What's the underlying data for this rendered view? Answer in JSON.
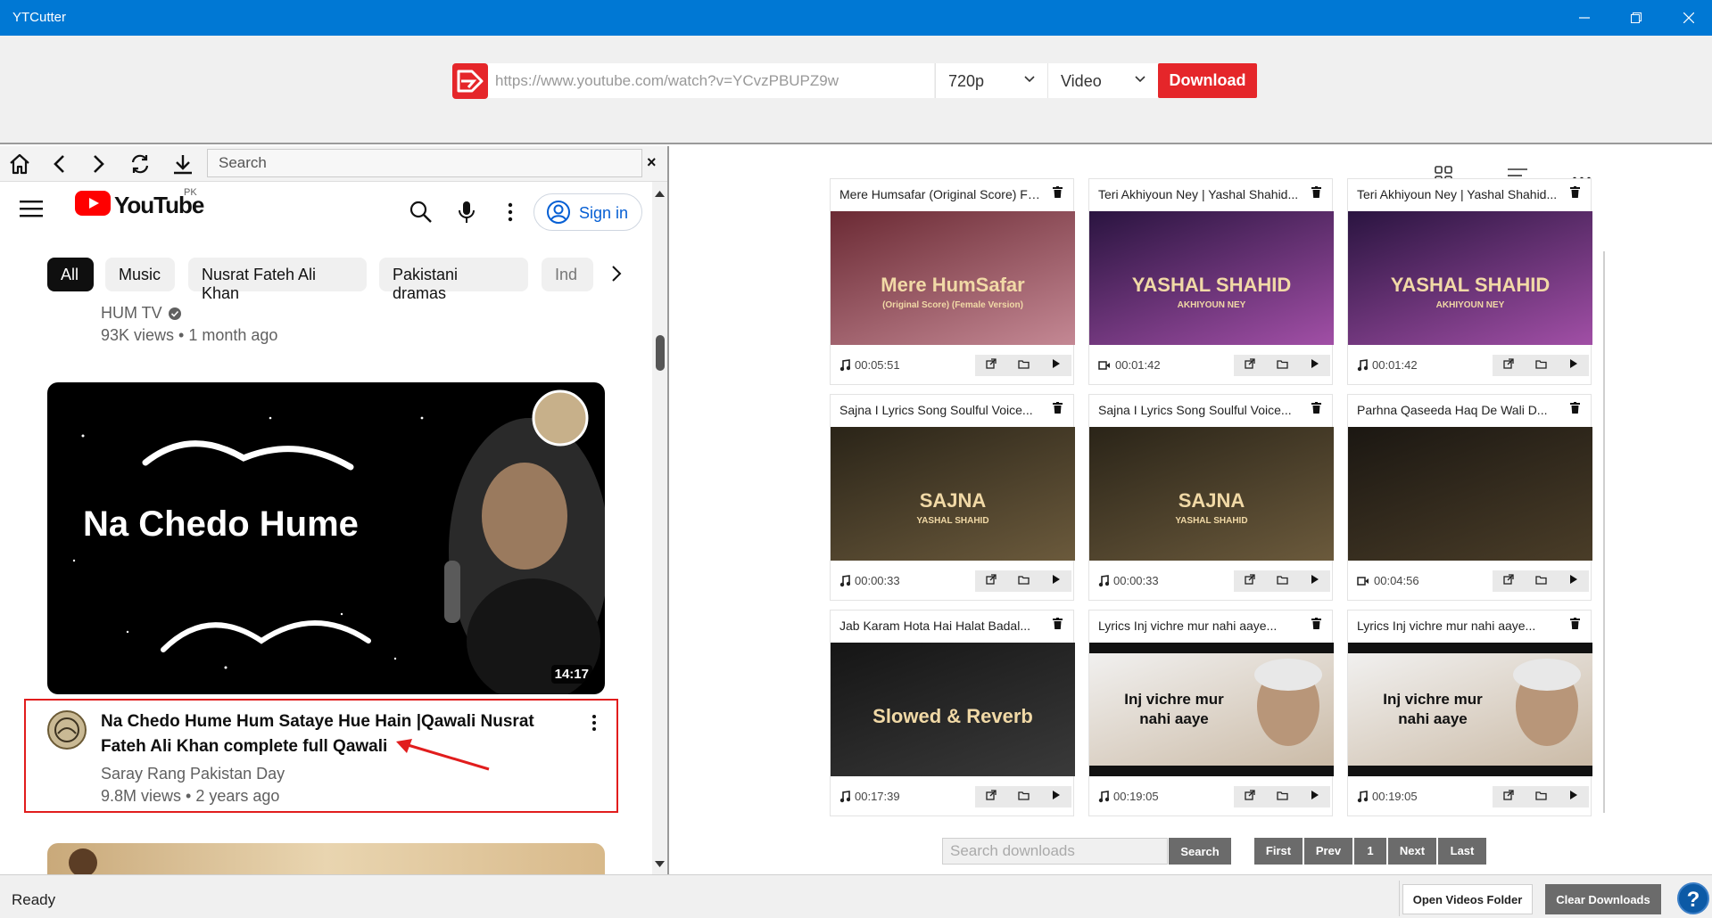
{
  "window": {
    "title": "YTCutter"
  },
  "topbar": {
    "url_placeholder": "https://www.youtube.com/watch?v=YCvzPBUPZ9w",
    "quality": "720p",
    "format": "Video",
    "download_label": "Download"
  },
  "browser": {
    "search_placeholder": "Search",
    "close_label": "×"
  },
  "youtube": {
    "logo_text": "YouTube",
    "region": "PK",
    "signin_label": "Sign in",
    "chips": [
      "All",
      "Music",
      "Nusrat Fateh Ali Khan",
      "Pakistani dramas",
      "Ind"
    ],
    "prev_video": {
      "channel": "HUM TV",
      "meta": "93K views • 1 month ago"
    },
    "video": {
      "thumb_text": "Na Chedo Hume",
      "duration": "14:17",
      "title": "Na Chedo Hume Hum Sataye Hue Hain |Qawali Nusrat Fateh Ali Khan complete full Qawali",
      "channel": "Saray Rang Pakistan Day",
      "meta": "9.8M views • 2 years ago"
    }
  },
  "downloads": {
    "cards": [
      {
        "title": "Mere Humsafar (Original Score) Ful...",
        "duration": "00:05:51",
        "kind": "audio",
        "thumb_text": "Mere HumSafar",
        "thumb_sub": "(Original Score) (Female Version)"
      },
      {
        "title": "Teri Akhiyoun Ney | Yashal Shahid...",
        "duration": "00:01:42",
        "kind": "video",
        "thumb_text": "YASHAL SHAHID",
        "thumb_sub": "AKHIYOUN NEY"
      },
      {
        "title": "Teri Akhiyoun Ney | Yashal Shahid...",
        "duration": "00:01:42",
        "kind": "audio",
        "thumb_text": "YASHAL SHAHID",
        "thumb_sub": "AKHIYOUN NEY"
      },
      {
        "title": "Sajna I Lyrics Song Soulful Voice...",
        "duration": "00:00:33",
        "kind": "audio",
        "thumb_text": "SAJNA",
        "thumb_sub": "YASHAL SHAHID"
      },
      {
        "title": "Sajna I Lyrics Song Soulful Voice...",
        "duration": "00:00:33",
        "kind": "audio",
        "thumb_text": "SAJNA",
        "thumb_sub": "YASHAL SHAHID"
      },
      {
        "title": "Parhna Qaseeda Haq De Wali D...",
        "duration": "00:04:56",
        "kind": "video",
        "thumb_text": "",
        "thumb_sub": ""
      },
      {
        "title": "Jab Karam Hota Hai Halat Badal...",
        "duration": "00:17:39",
        "kind": "audio",
        "thumb_text": "Slowed & Reverb",
        "thumb_sub": ""
      },
      {
        "title": "Lyrics Inj vichre mur nahi aaye...",
        "duration": "00:19:05",
        "kind": "audio",
        "thumb_text": "Inj vichre mur",
        "thumb_sub": "nahi aaye"
      },
      {
        "title": "Lyrics Inj vichre mur nahi aaye...",
        "duration": "00:19:05",
        "kind": "audio",
        "thumb_text": "Inj vichre mur",
        "thumb_sub": "nahi aaye"
      }
    ],
    "search_placeholder": "Search downloads",
    "search_label": "Search",
    "pager": {
      "first": "First",
      "prev": "Prev",
      "page": "1",
      "next": "Next",
      "last": "Last"
    }
  },
  "status": {
    "text": "Ready",
    "open_folder": "Open Videos Folder",
    "clear_downloads": "Clear Downloads",
    "help": "?"
  }
}
